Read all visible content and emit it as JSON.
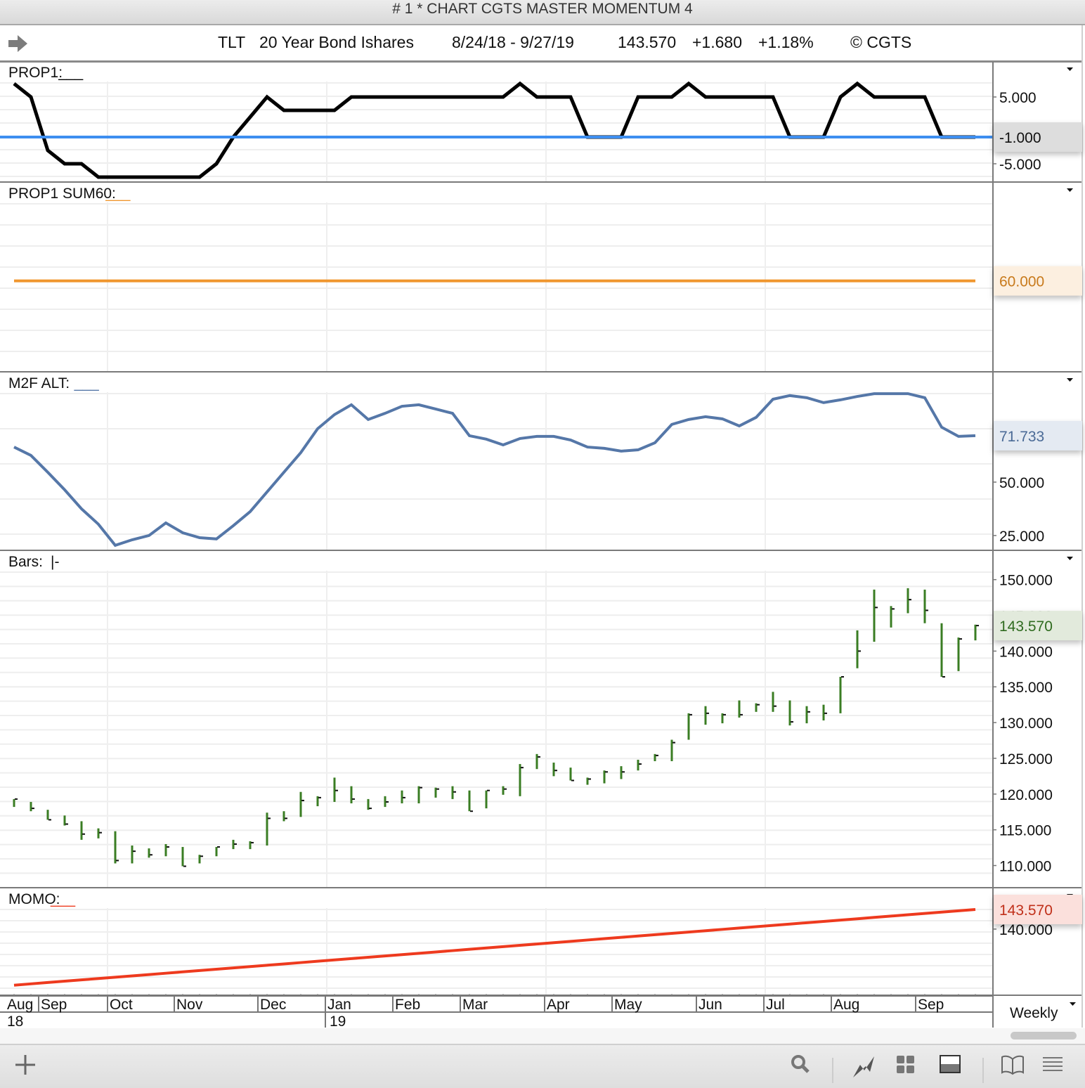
{
  "window": {
    "title": "# 1 * CHART CGTS MASTER MOMENTUM 4"
  },
  "infobar": {
    "symbol": "TLT",
    "name": "20 Year Bond Ishares",
    "date_range": "8/24/18 - 9/27/19",
    "last": "143.570",
    "change": "+1.680",
    "change_pct": "+1.18%",
    "copyright": "© CGTS"
  },
  "icons": [
    "arrow-right-icon",
    "dropdown-icon",
    "plus-icon",
    "search-icon",
    "chart-line-icon",
    "grid-icon",
    "panel-icon",
    "book-icon",
    "menu-icon"
  ],
  "periodicity": "Weekly",
  "xaxis": {
    "months": [
      "Aug",
      "Sep",
      "Oct",
      "Nov",
      "Dec",
      "Jan",
      "Feb",
      "Mar",
      "Apr",
      "May",
      "Jun",
      "Jul",
      "Aug",
      "Sep"
    ],
    "years": [
      "18",
      "19"
    ]
  },
  "colors": {
    "prop1": "#000000",
    "prop1_ref": "#3d8ef0",
    "sum60": "#f0962e",
    "m2f": "#5577a8",
    "bars": "#3a7d23",
    "momo": "#ee3a1e"
  },
  "chart_data": [
    {
      "type": "line",
      "title": "PROP1:",
      "legend_marker": "___",
      "yticks": [
        "5.000",
        "-5.000"
      ],
      "ylim": [
        -7.63,
        10.26
      ],
      "last_value_label": "-1.000",
      "reference_line": -1,
      "values": [
        7,
        5,
        -3,
        -5,
        -5,
        -7,
        -7,
        -7,
        -7,
        -7,
        -7,
        -7,
        -5,
        -1,
        2,
        5,
        3,
        3,
        3,
        3,
        5,
        5,
        5,
        5,
        5,
        5,
        5,
        5,
        5,
        5,
        7,
        5,
        5,
        5,
        -1,
        -1,
        -1,
        5,
        5,
        5,
        7,
        5,
        5,
        5,
        5,
        5,
        -1,
        -1,
        -1,
        5,
        7,
        5,
        5,
        5,
        5,
        -1,
        -1,
        -1
      ]
    },
    {
      "type": "line",
      "title": "PROP1 SUM60:",
      "legend_marker": "___",
      "ylim": [
        37,
        85
      ],
      "last_value_label": "60.000",
      "constant": 60
    },
    {
      "type": "line",
      "title": "M2F ALT:",
      "legend_marker": "___",
      "yticks": [
        "50.000",
        "25.000"
      ],
      "ylim": [
        18.4,
        101.3
      ],
      "last_value_label": "71.733",
      "values": [
        66.4,
        62.5,
        54.6,
        46.4,
        37.5,
        30.3,
        20.4,
        23.0,
        25.0,
        30.9,
        26.3,
        24.0,
        23.4,
        29.6,
        36.2,
        45.4,
        54.6,
        63.8,
        75.0,
        81.6,
        86.2,
        79.3,
        82.2,
        85.5,
        86.2,
        84.2,
        82.2,
        71.7,
        70.1,
        67.4,
        70.4,
        71.4,
        71.4,
        69.7,
        66.4,
        65.8,
        64.5,
        65.1,
        68.4,
        77.0,
        79.3,
        80.6,
        79.6,
        76.3,
        80.3,
        88.8,
        90.5,
        89.5,
        87.2,
        88.5,
        90.1,
        91.4,
        91.4,
        91.4,
        89.5,
        75.7,
        71.4,
        71.733
      ]
    },
    {
      "type": "bar",
      "subtype": "hlc",
      "title": "Bars:",
      "legend_marker": "|-",
      "yticks": [
        "150.000",
        "145.000",
        "140.000",
        "135.000",
        "130.000",
        "125.000",
        "120.000",
        "115.000",
        "110.000"
      ],
      "ylim": [
        107.0,
        154.0
      ],
      "last_value_label": "143.570",
      "high": [
        119.3,
        118.9,
        117.8,
        117.0,
        116.2,
        115.2,
        114.8,
        112.8,
        112.4,
        113.0,
        112.6,
        111.5,
        112.6,
        113.6,
        113.4,
        117.4,
        117.6,
        120.3,
        119.7,
        122.3,
        121.1,
        119.3,
        119.7,
        120.5,
        121.1,
        120.9,
        121.1,
        120.5,
        120.5,
        121.1,
        124.2,
        125.6,
        124.4,
        123.7,
        122.3,
        123.3,
        123.9,
        124.8,
        125.6,
        127.6,
        131.3,
        132.3,
        131.3,
        133.1,
        132.7,
        134.3,
        133.1,
        132.3,
        132.5,
        136.4,
        142.9,
        148.6,
        146.3,
        148.8,
        148.6,
        143.9,
        141.9,
        143.7
      ],
      "low": [
        118.2,
        117.6,
        116.4,
        115.6,
        113.6,
        113.8,
        110.3,
        110.3,
        111.1,
        111.3,
        109.9,
        110.3,
        111.3,
        112.3,
        112.3,
        112.8,
        116.2,
        116.8,
        118.3,
        118.9,
        118.7,
        117.8,
        118.2,
        118.7,
        118.7,
        119.5,
        119.3,
        117.6,
        118.0,
        119.9,
        119.7,
        123.5,
        122.5,
        121.9,
        121.3,
        121.5,
        122.1,
        123.3,
        124.6,
        124.6,
        127.6,
        129.7,
        129.9,
        130.7,
        131.5,
        131.5,
        129.6,
        129.9,
        130.3,
        131.3,
        137.6,
        141.3,
        143.3,
        145.3,
        143.9,
        136.4,
        137.2,
        141.5
      ],
      "close": [
        119.3,
        118.0,
        116.4,
        115.8,
        114.4,
        114.6,
        110.7,
        112.0,
        111.5,
        112.6,
        109.9,
        111.3,
        112.6,
        113.0,
        113.2,
        116.6,
        116.6,
        119.1,
        119.5,
        120.5,
        119.3,
        118.0,
        118.9,
        119.5,
        120.9,
        120.7,
        120.3,
        117.6,
        120.5,
        120.7,
        123.7,
        125.2,
        123.3,
        121.9,
        122.1,
        123.1,
        123.1,
        124.2,
        125.4,
        127.2,
        131.1,
        131.3,
        131.1,
        131.1,
        132.5,
        132.3,
        130.1,
        131.5,
        131.3,
        136.4,
        140.0,
        146.1,
        145.9,
        147.2,
        145.7,
        136.4,
        141.7,
        143.57
      ]
    },
    {
      "type": "line",
      "title": "MOMO:",
      "legend_marker": "___",
      "yticks": [
        "140.000"
      ],
      "ylim": [
        128.1,
        147.4
      ],
      "last_value_label": "143.570",
      "start": 129.8,
      "end": 143.57
    }
  ]
}
